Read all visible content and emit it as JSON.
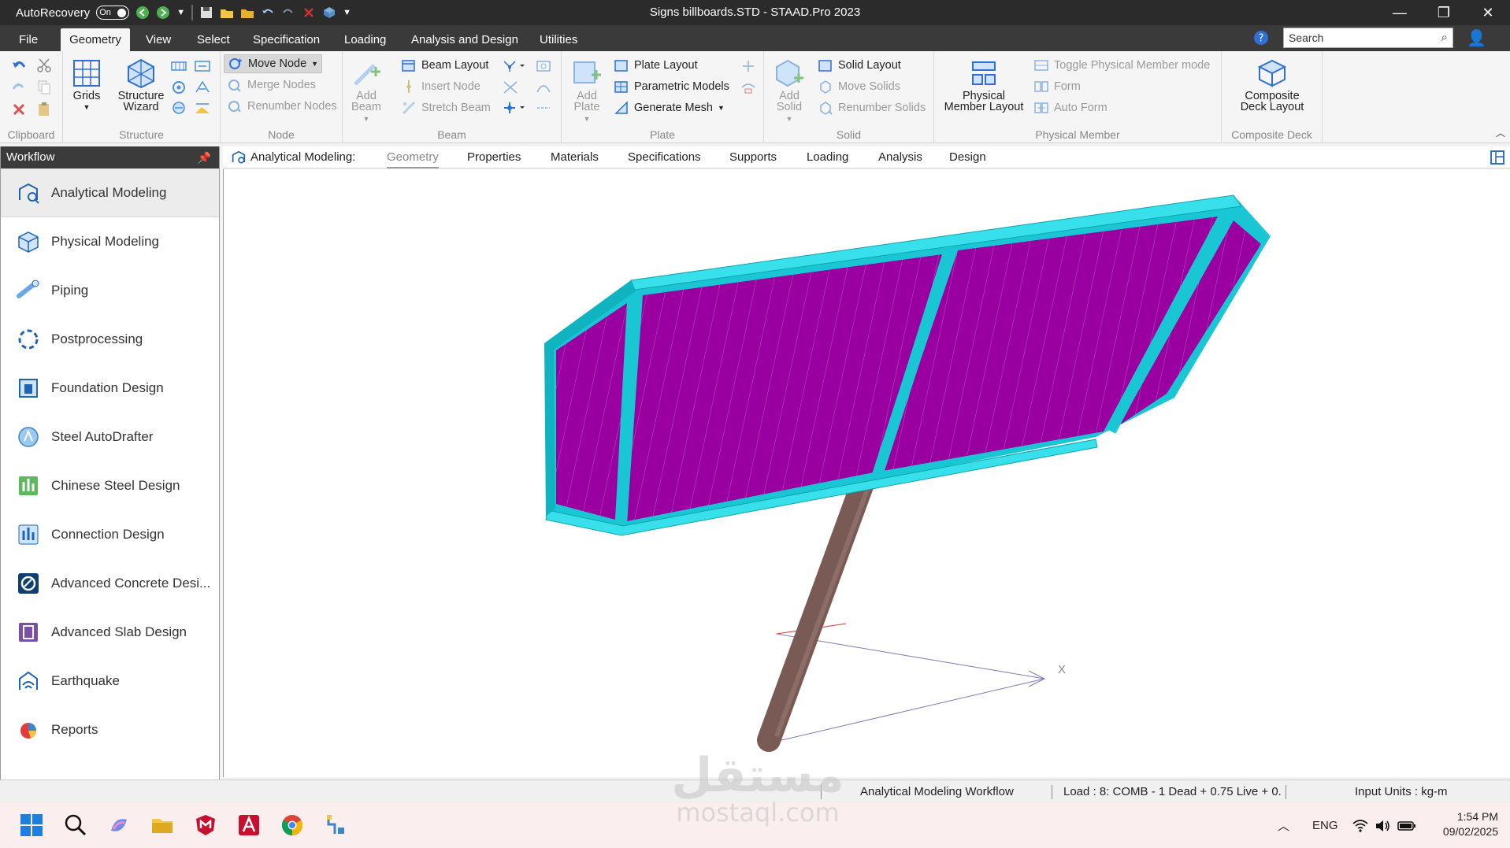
{
  "titlebar": {
    "autorecovery_label": "AutoRecovery",
    "autorecovery_toggle": "On",
    "window_title": "Signs billboards.STD - STAAD.Pro 2023"
  },
  "ribbon_tabs": [
    "File",
    "Geometry",
    "View",
    "Select",
    "Specification",
    "Loading",
    "Analysis and Design",
    "Utilities"
  ],
  "search": {
    "placeholder": "Search"
  },
  "ribbon": {
    "clipboard": {
      "label": "Clipboard"
    },
    "structure": {
      "label": "Structure",
      "grids": "Grids",
      "wizard_line1": "Structure",
      "wizard_line2": "Wizard"
    },
    "node": {
      "label": "Node",
      "move": "Move Node",
      "merge": "Merge Nodes",
      "renumber": "Renumber Nodes"
    },
    "beam": {
      "label": "Beam",
      "add_line1": "Add",
      "add_line2": "Beam",
      "layout": "Beam Layout",
      "insert": "Insert Node",
      "stretch": "Stretch Beam"
    },
    "plate": {
      "label": "Plate",
      "add_line1": "Add",
      "add_line2": "Plate",
      "layout": "Plate Layout",
      "parametric": "Parametric Models",
      "mesh": "Generate Mesh"
    },
    "solid": {
      "label": "Solid",
      "add_line1": "Add",
      "add_line2": "Solid",
      "layout": "Solid Layout",
      "move": "Move Solids",
      "renumber": "Renumber Solids"
    },
    "physical_member": {
      "label": "Physical Member",
      "layout_line1": "Physical",
      "layout_line2": "Member Layout",
      "toggle": "Toggle Physical Member mode",
      "form": "Form",
      "auto_form": "Auto Form"
    },
    "composite_deck": {
      "label": "Composite Deck",
      "layout_line1": "Composite",
      "layout_line2": "Deck Layout"
    }
  },
  "workflow": {
    "title": "Workflow",
    "items": [
      "Analytical Modeling",
      "Physical Modeling",
      "Piping",
      "Postprocessing",
      "Foundation Design",
      "Steel AutoDrafter",
      "Chinese Steel Design",
      "Connection Design",
      "Advanced Concrete Desi...",
      "Advanced Slab Design",
      "Earthquake",
      "Reports"
    ]
  },
  "subtabs": {
    "label": "Analytical Modeling:",
    "items": [
      "Geometry",
      "Properties",
      "Materials",
      "Specifications",
      "Supports",
      "Loading",
      "Analysis",
      "Design"
    ]
  },
  "viewport": {
    "axis_label": "X"
  },
  "statusbar": {
    "workflow": "Analytical Modeling Workflow",
    "load": "Load : 8: COMB - 1 Dead + 0.75 Live + 0.",
    "units": "Input Units : kg-m"
  },
  "taskbar": {
    "lang": "ENG",
    "time": "1:54 PM",
    "date": "09/02/2025"
  },
  "watermark": {
    "line1": "مستقل",
    "line2": "mostaql.com"
  },
  "colors": {
    "panel_fill": "#9a00a0",
    "frame": "#19c7d4",
    "post": "#7a5a55"
  }
}
